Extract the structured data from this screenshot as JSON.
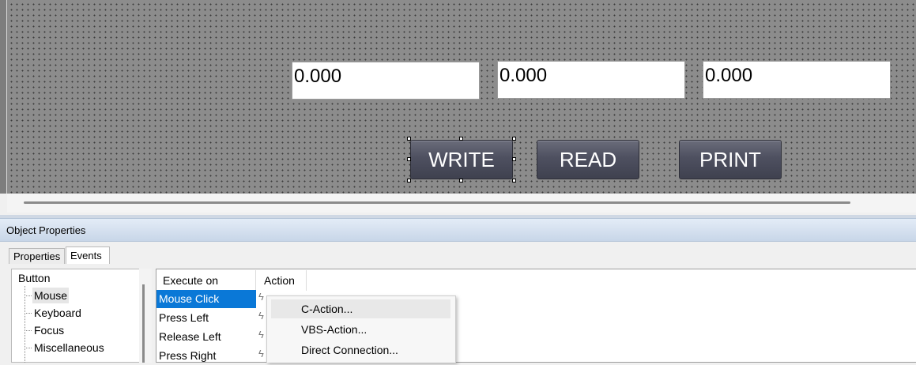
{
  "canvas": {
    "io_fields": [
      "0.000",
      "0.000",
      "0.000"
    ],
    "buttons": {
      "write": "WRITE",
      "read": "READ",
      "print": "PRINT"
    }
  },
  "panel": {
    "title": "Object Properties",
    "tabs": {
      "properties": "Properties",
      "events": "Events"
    },
    "tree": {
      "root": "Button",
      "items": [
        "Mouse",
        "Keyboard",
        "Focus",
        "Miscellaneous"
      ],
      "selected": "Mouse"
    },
    "grid": {
      "headers": {
        "execute_on": "Execute on",
        "action": "Action"
      },
      "rows": [
        "Mouse Click",
        "Press Left",
        "Release Left",
        "Press Right"
      ],
      "selected": "Mouse Click"
    },
    "context_menu": [
      "C-Action...",
      "VBS-Action...",
      "Direct Connection..."
    ]
  },
  "colors": {
    "selection": "#0a78d7",
    "canvas": "#8c8c8c",
    "button": "#4e5060"
  },
  "icons": {
    "event_action": "lightning-icon"
  }
}
